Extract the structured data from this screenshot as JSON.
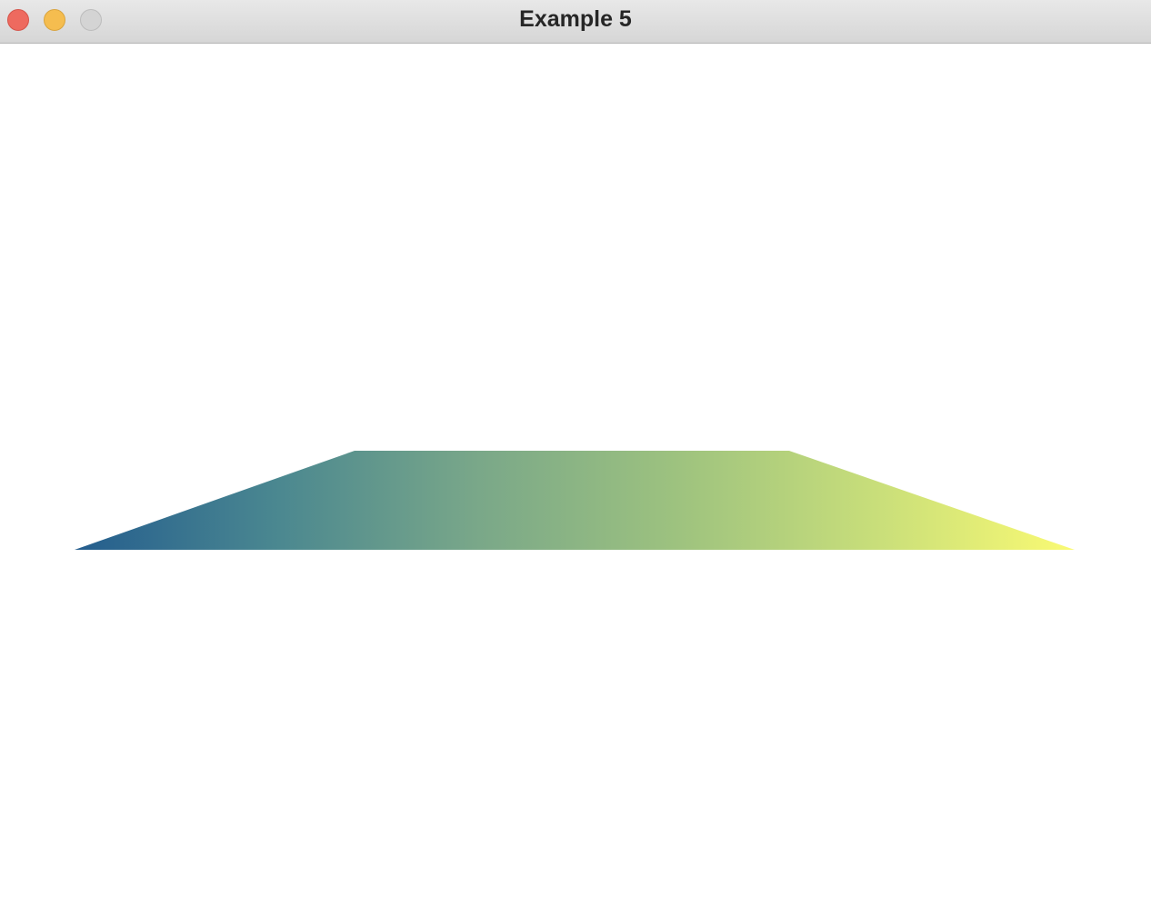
{
  "window": {
    "title": "Example 5"
  },
  "canvas": {
    "shape": "trapezoid",
    "fill": "horizontal-gradient",
    "gradient_colors": [
      "#245d8e",
      "#4a8790",
      "#79a789",
      "#9dc27f",
      "#c8de7a",
      "#fafa73"
    ]
  }
}
